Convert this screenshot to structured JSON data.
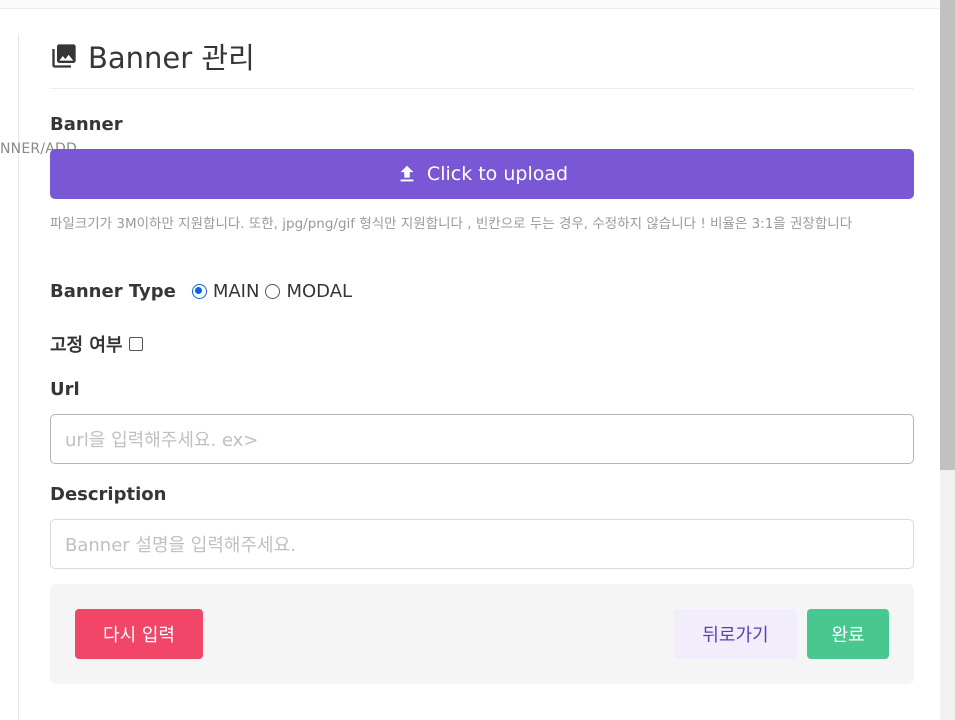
{
  "route": {
    "text": "NNER/ADD"
  },
  "header": {
    "title": "Banner 관리",
    "icon": "image-icon"
  },
  "banner": {
    "label": "Banner",
    "upload_label": "Click to upload",
    "upload_icon": "upload-icon",
    "help_text": "파일크기가 3M이하만 지원합니다. 또한, jpg/png/gif 형식만 지원합니다 , 빈칸으로 두는 경우, 수정하지 않습니다 ! 비율은 3:1을 권장합니다"
  },
  "banner_type": {
    "label": "Banner Type",
    "options": [
      {
        "label": "MAIN",
        "checked": true
      },
      {
        "label": "MODAL",
        "checked": false
      }
    ]
  },
  "fixed": {
    "label": "고정 여부",
    "checked": false
  },
  "url": {
    "label": "Url",
    "value": "",
    "placeholder": "url을 입력해주세요. ex>"
  },
  "description": {
    "label": "Description",
    "value": "",
    "placeholder": "Banner 설명을 입력해주세요."
  },
  "actions": {
    "reset_label": "다시 입력",
    "back_label": "뒤로가기",
    "done_label": "완료"
  },
  "colors": {
    "primary": "#7957d5",
    "danger": "#f14668",
    "success": "#48c78e",
    "back_bg": "#f1edfb",
    "radio_accent": "#0b64d8"
  }
}
